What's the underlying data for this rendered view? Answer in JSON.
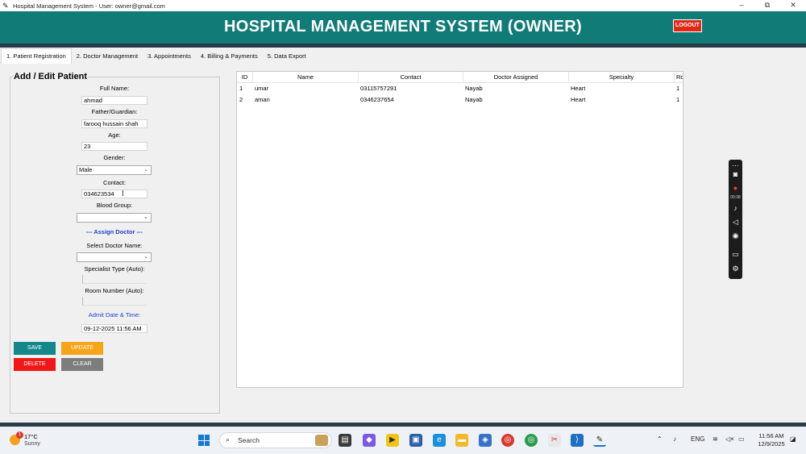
{
  "window": {
    "title": "Hospital Management System - User: owner@gmail.com",
    "minimize": "–",
    "maximize": "⧉",
    "close": "✕"
  },
  "header": {
    "title": "HOSPITAL MANAGEMENT SYSTEM (OWNER)",
    "logout_label": "LOGOUT"
  },
  "tabs": [
    {
      "label": "1. Patient Registration"
    },
    {
      "label": "2. Doctor Management"
    },
    {
      "label": "3. Appointments"
    },
    {
      "label": "4. Billing & Payments"
    },
    {
      "label": "5. Data Export"
    }
  ],
  "form": {
    "title": "Add / Edit Patient",
    "full_name_label": "Full Name:",
    "full_name_value": "ahmad",
    "father_label": "Father/Guardian:",
    "father_value": "farooq hussain shah",
    "age_label": "Age:",
    "age_value": "23",
    "gender_label": "Gender:",
    "gender_value": "Male",
    "contact_label": "Contact:",
    "contact_value": "034623534",
    "blood_label": "Blood Group:",
    "blood_value": "",
    "assign_doctor_heading": "--- Assign Doctor ---",
    "doctor_label": "Select Doctor Name:",
    "doctor_value": "",
    "specialist_label": "Specialist Type (Auto):",
    "room_label": "Room Number (Auto):",
    "admit_label": "Admit Date & Time:",
    "admit_value": "09-12-2025 11:56 AM"
  },
  "buttons": {
    "save": "SAVE",
    "update": "UPDATE",
    "delete": "DELETE",
    "clear": "CLEAR"
  },
  "table": {
    "columns": [
      "ID",
      "Name",
      "Contact",
      "Doctor Assigned",
      "Specialty",
      "Ro"
    ],
    "rows": [
      [
        "1",
        "umar",
        "03115757291",
        "Nayab",
        "Heart",
        "1"
      ],
      [
        "2",
        "aman",
        "0346237654",
        "Nayab",
        "Heart",
        "1"
      ]
    ]
  },
  "recorder": {
    "timer": "00:38"
  },
  "taskbar": {
    "weather_temp": "17°C",
    "weather_cond": "Sunny",
    "weather_badge": "1",
    "search_placeholder": "Search",
    "language": "ENG",
    "time": "11:56 AM",
    "date": "12/9/2025"
  },
  "colors": {
    "header": "#107b77",
    "logout": "#e02818",
    "save": "#13878a",
    "update": "#f6a51a",
    "delete": "#ee1818",
    "clear": "#7d7d7d",
    "link_blue": "#1f3fc8"
  }
}
